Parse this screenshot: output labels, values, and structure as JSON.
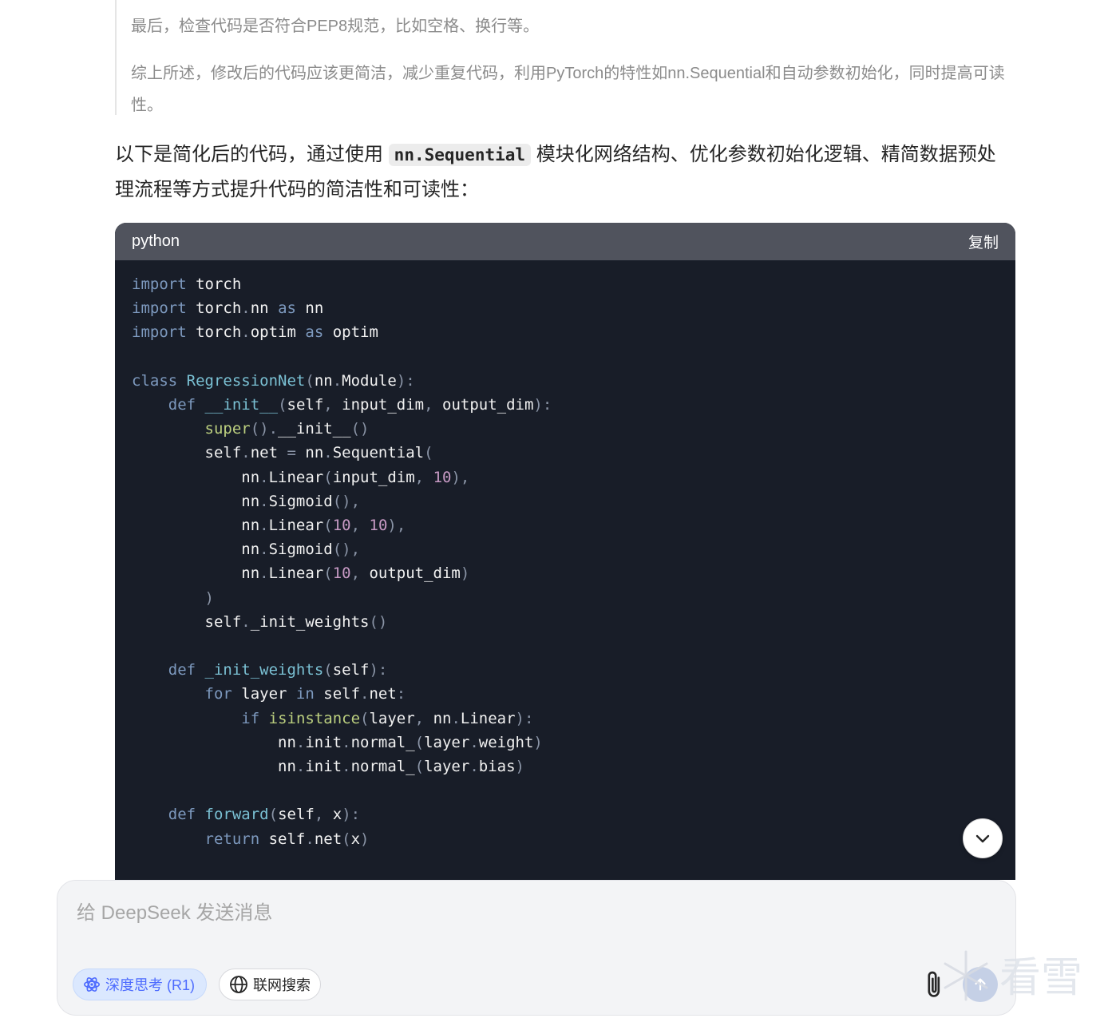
{
  "quote": {
    "line1": "最后，检查代码是否符合PEP8规范，比如空格、换行等。",
    "line2": "综上所述，修改后的代码应该更简洁，减少重复代码，利用PyTorch的特性如nn.Sequential和自动参数初始化，同时提高可读性。"
  },
  "intro": {
    "before": "以下是简化后的代码，通过使用 ",
    "code": "nn.Sequential",
    "after": " 模块化网络结构、优化参数初始化逻辑、精简数据预处理流程等方式提升代码的简洁性和可读性："
  },
  "codeblock": {
    "language": "python",
    "copy_label": "复制"
  },
  "composer": {
    "placeholder": "给 DeepSeek 发送消息",
    "deep_think_label": "深度思考 (R1)",
    "web_search_label": "联网搜索"
  },
  "icons": {
    "deep_think": "atom-icon",
    "web_search": "globe-icon",
    "attach": "paperclip-icon",
    "send": "arrow-up-icon",
    "scroll": "chevron-down-icon"
  },
  "colors": {
    "accent": "#4d6bfe",
    "code_bg": "#181d28",
    "code_header_bg": "#50535d"
  },
  "watermark": {
    "text": "看雪"
  }
}
